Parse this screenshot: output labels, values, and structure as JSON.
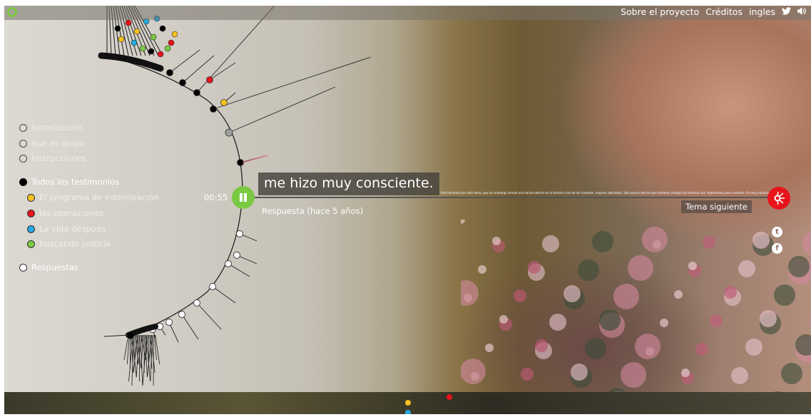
{
  "topbar": {
    "links": [
      "Sobre el proyecto",
      "Créditos",
      "ingles"
    ],
    "icons": [
      "twitter-icon",
      "volume-icon"
    ]
  },
  "nav": {
    "items": [
      {
        "label": "Introducción",
        "dot": "hollow"
      },
      {
        "label": "que es quipu",
        "dot": "hollow"
      },
      {
        "label": "Instrucciones",
        "dot": "hollow"
      },
      {
        "label": "Todos los testimonios",
        "dot": "#000000"
      },
      {
        "label": "El programa de esterilización",
        "dot": "#f7c120"
      },
      {
        "label": "las operaciones",
        "dot": "#e8141b"
      },
      {
        "label": "La vida después",
        "dot": "#27a9e1"
      },
      {
        "label": "buscando justicia",
        "dot": "#7ac943"
      },
      {
        "label": "Respuestas",
        "dot": "#ffffff"
      }
    ]
  },
  "player": {
    "time": "00:55",
    "caption": "me hizo muy consciente.",
    "transcript": "Precisamente por esta tema, que sin embargo siendo una herida abierta en la historia viva de los nuestros, mujeres afectadas. Solo quería decirte que estamos contigo tus historias son importantes para nosotros. Es muy importante",
    "response_label": "Respuesta (hace 5 años)",
    "next_label": "Tema siguiente"
  },
  "social": [
    "twitter-icon",
    "facebook-icon"
  ],
  "colors": {
    "green": "#7ac943",
    "red": "#e8141b",
    "yellow": "#f7c120",
    "blue": "#27a9e1"
  }
}
